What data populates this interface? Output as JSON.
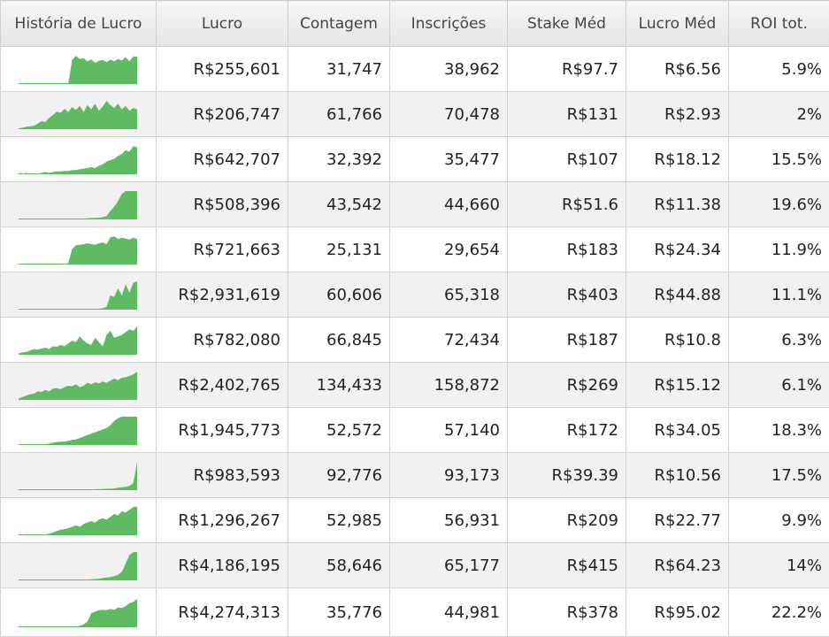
{
  "columns": [
    "História de Lucro",
    "Lucro",
    "Contagem",
    "Inscrições",
    "Stake Méd",
    "Lucro Méd",
    "ROI tot."
  ],
  "spark_color": "#5fbb62",
  "rows": [
    {
      "lucro": "R$255,601",
      "contagem": "31,747",
      "inscricoes": "38,962",
      "stake": "R$97.7",
      "lucro_med": "R$6.56",
      "roi": "5.9%",
      "spark": [
        0,
        0,
        0,
        0,
        0,
        0,
        0,
        0,
        0,
        0,
        0,
        0,
        0,
        0,
        0.85,
        1.0,
        0.88,
        0.92,
        0.8,
        0.87,
        0.75,
        0.82,
        0.85,
        0.78,
        0.86,
        0.8,
        0.88,
        0.83,
        0.95,
        0.8,
        0.98,
        0.96
      ]
    },
    {
      "lucro": "R$206,747",
      "contagem": "61,766",
      "inscricoes": "70,478",
      "stake": "R$131",
      "lucro_med": "R$2.93",
      "roi": "2%",
      "spark": [
        0.02,
        0.05,
        0.08,
        0.1,
        0.12,
        0.2,
        0.28,
        0.25,
        0.4,
        0.5,
        0.62,
        0.58,
        0.72,
        0.6,
        0.78,
        0.68,
        0.82,
        0.6,
        0.85,
        0.7,
        0.9,
        0.65,
        0.8,
        1.0,
        0.85,
        0.75,
        0.9,
        0.7,
        0.82,
        0.65,
        0.75,
        0.7
      ]
    },
    {
      "lucro": "R$642,707",
      "contagem": "32,392",
      "inscricoes": "35,477",
      "stake": "R$107",
      "lucro_med": "R$18.12",
      "roi": "15.5%",
      "spark": [
        0,
        0,
        0.05,
        0,
        0,
        0,
        0.05,
        0.08,
        0.05,
        0.08,
        0.1,
        0.1,
        0.12,
        0.12,
        0.15,
        0.15,
        0.18,
        0.2,
        0.22,
        0.25,
        0.22,
        0.3,
        0.35,
        0.45,
        0.5,
        0.55,
        0.65,
        0.72,
        0.85,
        0.8,
        1.0,
        0.95
      ]
    },
    {
      "lucro": "R$508,396",
      "contagem": "43,542",
      "inscricoes": "44,660",
      "stake": "R$51.6",
      "lucro_med": "R$11.38",
      "roi": "19.6%",
      "spark": [
        0.02,
        0.02,
        0.02,
        0.02,
        0.02,
        0.02,
        0.02,
        0.02,
        0.02,
        0.02,
        0.02,
        0.02,
        0.02,
        0.02,
        0.02,
        0.03,
        0.03,
        0.03,
        0.04,
        0.05,
        0.05,
        0.06,
        0.08,
        0.12,
        0.3,
        0.45,
        0.65,
        0.9,
        1.0,
        1.0,
        1.0,
        1.0
      ]
    },
    {
      "lucro": "R$721,663",
      "contagem": "25,131",
      "inscricoes": "29,654",
      "stake": "R$183",
      "lucro_med": "R$24.34",
      "roi": "11.9%",
      "spark": [
        0.02,
        0.02,
        0.02,
        0.02,
        0.02,
        0.02,
        0.02,
        0.02,
        0.02,
        0.02,
        0.02,
        0.02,
        0.02,
        0.05,
        0.55,
        0.68,
        0.7,
        0.72,
        0.75,
        0.72,
        0.7,
        0.75,
        0.78,
        0.72,
        0.95,
        1.0,
        0.9,
        0.95,
        0.92,
        0.88,
        0.95,
        0.9
      ]
    },
    {
      "lucro": "R$2,931,619",
      "contagem": "60,606",
      "inscricoes": "65,318",
      "stake": "R$403",
      "lucro_med": "R$44.88",
      "roi": "11.1%",
      "spark": [
        0.02,
        0.02,
        0.02,
        0.02,
        0.02,
        0.02,
        0.02,
        0.02,
        0.02,
        0.02,
        0.02,
        0.02,
        0.02,
        0.02,
        0.02,
        0.02,
        0.02,
        0.02,
        0.02,
        0.02,
        0.02,
        0.03,
        0.05,
        0.1,
        0.5,
        0.45,
        0.75,
        0.5,
        0.9,
        0.6,
        0.95,
        1.0
      ]
    },
    {
      "lucro": "R$782,080",
      "contagem": "66,845",
      "inscricoes": "72,434",
      "stake": "R$187",
      "lucro_med": "R$10.8",
      "roi": "6.3%",
      "spark": [
        0.05,
        0.08,
        0.1,
        0.15,
        0.2,
        0.18,
        0.22,
        0.25,
        0.2,
        0.3,
        0.28,
        0.35,
        0.3,
        0.4,
        0.5,
        0.45,
        0.65,
        0.5,
        0.4,
        0.35,
        0.6,
        0.45,
        0.3,
        0.7,
        0.85,
        0.6,
        0.65,
        0.7,
        0.8,
        0.9,
        0.85,
        1.0
      ]
    },
    {
      "lucro": "R$2,402,765",
      "contagem": "134,433",
      "inscricoes": "158,872",
      "stake": "R$269",
      "lucro_med": "R$15.12",
      "roi": "6.1%",
      "spark": [
        0.05,
        0.1,
        0.15,
        0.2,
        0.22,
        0.3,
        0.28,
        0.35,
        0.3,
        0.4,
        0.42,
        0.38,
        0.45,
        0.5,
        0.48,
        0.55,
        0.45,
        0.5,
        0.6,
        0.55,
        0.62,
        0.58,
        0.65,
        0.6,
        0.68,
        0.75,
        0.7,
        0.78,
        0.8,
        0.85,
        0.9,
        1.0
      ]
    },
    {
      "lucro": "R$1,945,773",
      "contagem": "52,572",
      "inscricoes": "57,140",
      "stake": "R$172",
      "lucro_med": "R$34.05",
      "roi": "18.3%",
      "spark": [
        0.02,
        0.02,
        0.02,
        0.02,
        0.02,
        0.02,
        0.02,
        0.03,
        0.05,
        0.08,
        0.1,
        0.12,
        0.12,
        0.15,
        0.18,
        0.2,
        0.25,
        0.3,
        0.35,
        0.4,
        0.45,
        0.5,
        0.55,
        0.6,
        0.7,
        0.85,
        0.95,
        1.0,
        1.0,
        1.0,
        1.0,
        1.0
      ]
    },
    {
      "lucro": "R$983,593",
      "contagem": "92,776",
      "inscricoes": "93,173",
      "stake": "R$39.39",
      "lucro_med": "R$10.56",
      "roi": "17.5%",
      "spark": [
        0.02,
        0.02,
        0.02,
        0.02,
        0.02,
        0.02,
        0.02,
        0.02,
        0.02,
        0.02,
        0.02,
        0.02,
        0.02,
        0.02,
        0.02,
        0.02,
        0.02,
        0.02,
        0.03,
        0.03,
        0.03,
        0.04,
        0.04,
        0.05,
        0.05,
        0.06,
        0.08,
        0.1,
        0.12,
        0.15,
        0.25,
        1.0
      ]
    },
    {
      "lucro": "R$1,296,267",
      "contagem": "52,985",
      "inscricoes": "56,931",
      "stake": "R$209",
      "lucro_med": "R$22.77",
      "roi": "9.9%",
      "spark": [
        0.02,
        0.02,
        0.02,
        0.02,
        0.02,
        0.02,
        0.02,
        0.03,
        0.05,
        0.1,
        0.15,
        0.2,
        0.22,
        0.25,
        0.3,
        0.35,
        0.3,
        0.4,
        0.45,
        0.5,
        0.45,
        0.55,
        0.6,
        0.55,
        0.65,
        0.75,
        0.7,
        0.85,
        0.8,
        0.9,
        1.0,
        1.0
      ]
    },
    {
      "lucro": "R$4,186,195",
      "contagem": "58,646",
      "inscricoes": "65,177",
      "stake": "R$415",
      "lucro_med": "R$64.23",
      "roi": "14%",
      "spark": [
        0.02,
        0.02,
        0.02,
        0.02,
        0.02,
        0.02,
        0.02,
        0.02,
        0.02,
        0.02,
        0.02,
        0.02,
        0.02,
        0.02,
        0.02,
        0.02,
        0.02,
        0.03,
        0.03,
        0.04,
        0.05,
        0.06,
        0.08,
        0.1,
        0.12,
        0.15,
        0.2,
        0.3,
        0.6,
        0.9,
        1.0,
        1.0
      ]
    },
    {
      "lucro": "R$4,274,313",
      "contagem": "35,776",
      "inscricoes": "44,981",
      "stake": "R$378",
      "lucro_med": "R$95.02",
      "roi": "22.2%",
      "spark": [
        0.02,
        0.02,
        0.02,
        0.02,
        0.02,
        0.02,
        0.02,
        0.02,
        0.02,
        0.02,
        0.02,
        0.02,
        0.02,
        0.02,
        0.02,
        0.03,
        0.05,
        0.1,
        0.2,
        0.5,
        0.55,
        0.6,
        0.62,
        0.6,
        0.65,
        0.62,
        0.7,
        0.68,
        0.75,
        0.85,
        0.9,
        1.0
      ]
    }
  ]
}
